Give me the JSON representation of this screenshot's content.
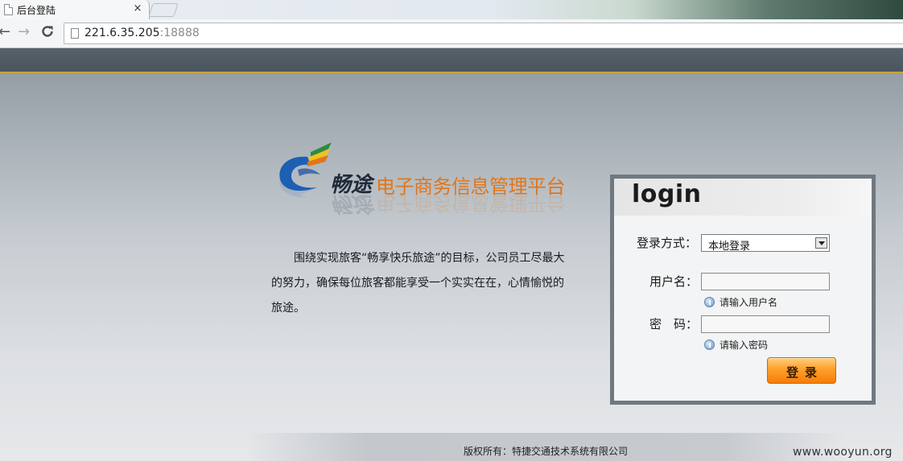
{
  "browser": {
    "tab_title": "后台登陆",
    "tab_close": "×",
    "url_host": "221.6.35.205",
    "url_port": ":18888",
    "back_glyph": "←",
    "forward_glyph": "→",
    "reload_glyph": "C"
  },
  "logo": {
    "brand": "畅途",
    "subtitle": "电子商务信息管理平台",
    "colors": {
      "blue": "#1d5fb3",
      "orange": "#e0761a",
      "green": "#2e8b3d",
      "yellow": "#f2c21a"
    }
  },
  "intro": {
    "text": "围绕实现旅客“畅享快乐旅途”的目标，公司员工尽最大的努力，确保每位旅客都能享受一个实实在在，心情愉悦的旅途。"
  },
  "login": {
    "title": "login",
    "mode_label": "登录方式：",
    "mode_selected": "本地登录",
    "username_label": "用户名：",
    "username_value": "",
    "username_hint": "请输入用户名",
    "password_label": "密　码：",
    "password_value": "",
    "password_hint": "请输入密码",
    "submit_label": "登录"
  },
  "footer": {
    "copyright": "版权所有：特捷交通技术系统有限公司",
    "watermark": "www.wooyun.org"
  },
  "colors": {
    "topbar": "#4d5962",
    "accent_line": "#c9a23d",
    "button_orange": "#ff9f2b"
  }
}
